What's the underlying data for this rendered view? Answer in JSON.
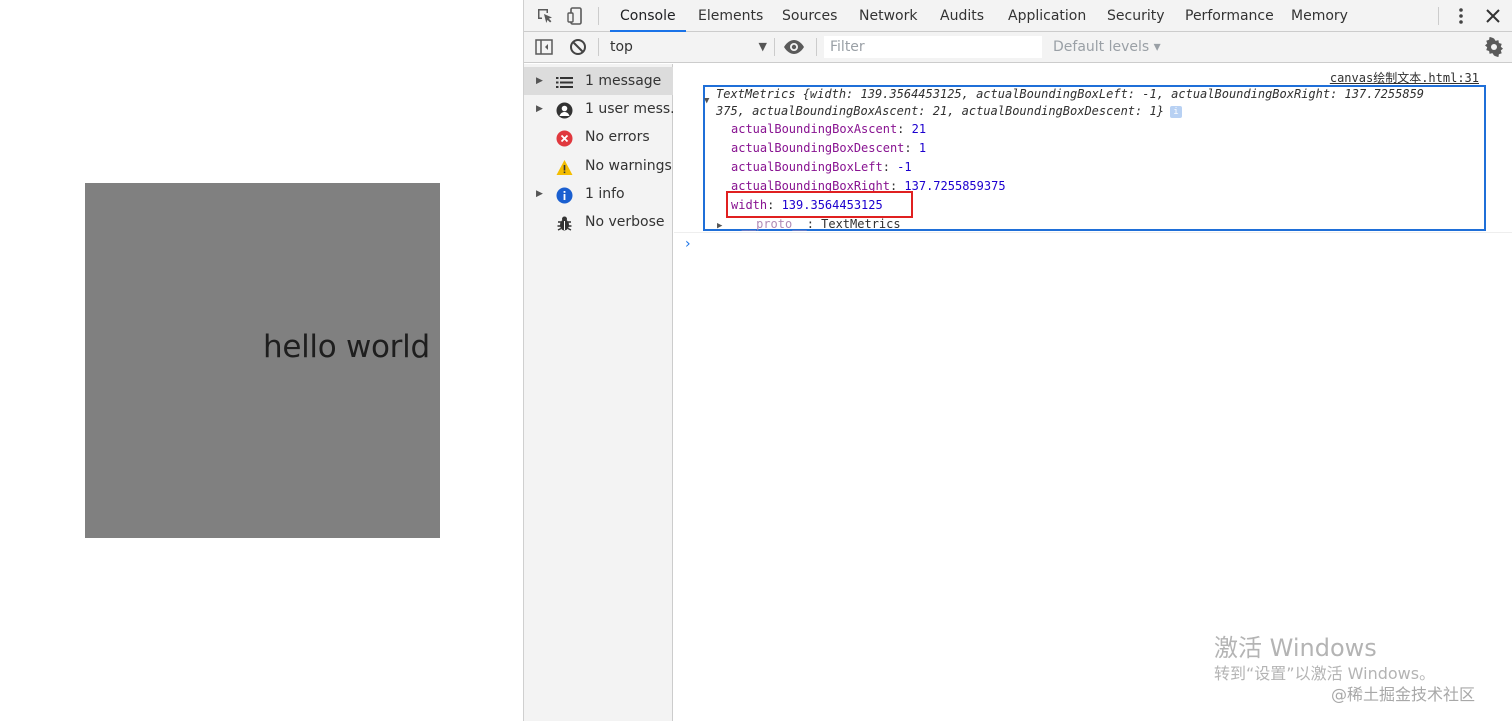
{
  "page": {
    "canvas_text": "hello world",
    "canvas_color": "#808080"
  },
  "devtools": {
    "tabs": [
      "Console",
      "Elements",
      "Sources",
      "Network",
      "Audits",
      "Application",
      "Security",
      "Performance",
      "Memory"
    ],
    "active_tab": "Console",
    "toolbar": {
      "context": "top",
      "filter_placeholder": "Filter",
      "levels_label": "Default levels ▾"
    },
    "sidebar": {
      "items": [
        {
          "label": "1 message",
          "icon": "list-icon",
          "expandable": true,
          "selected": true
        },
        {
          "label": "1 user mess...",
          "icon": "user-icon",
          "expandable": true,
          "selected": false
        },
        {
          "label": "No errors",
          "icon": "error-icon",
          "expandable": false,
          "selected": false
        },
        {
          "label": "No warnings",
          "icon": "warning-icon",
          "expandable": false,
          "selected": false
        },
        {
          "label": "1 info",
          "icon": "info-icon",
          "expandable": true,
          "selected": false
        },
        {
          "label": "No verbose",
          "icon": "bug-icon",
          "expandable": false,
          "selected": false
        }
      ]
    },
    "console": {
      "source_link": "canvas绘制文本.html:31",
      "preview_line1": "TextMetrics {width: 139.3564453125, actualBoundingBoxLeft: -1, actualBoundingBoxRight: 137.7255859",
      "preview_line2": "375, actualBoundingBoxAscent: 21, actualBoundingBoxDescent: 1}",
      "properties": [
        {
          "key": "actualBoundingBoxAscent",
          "value": "21"
        },
        {
          "key": "actualBoundingBoxDescent",
          "value": "1"
        },
        {
          "key": "actualBoundingBoxLeft",
          "value": "-1"
        },
        {
          "key": "actualBoundingBoxRight",
          "value": "137.7255859375"
        },
        {
          "key": "width",
          "value": "139.3564453125"
        }
      ],
      "proto_label": "__proto__",
      "proto_value": ": TextMetrics",
      "prompt": "›"
    },
    "colors": {
      "highlight_box": "#1f6fd8",
      "width_highlight": "#e02020",
      "accent": "#1a73e8"
    }
  },
  "watermark": {
    "title": "激活 Windows",
    "subtitle": "转到“设置”以激活 Windows。",
    "credit": "@稀土掘金技术社区"
  }
}
